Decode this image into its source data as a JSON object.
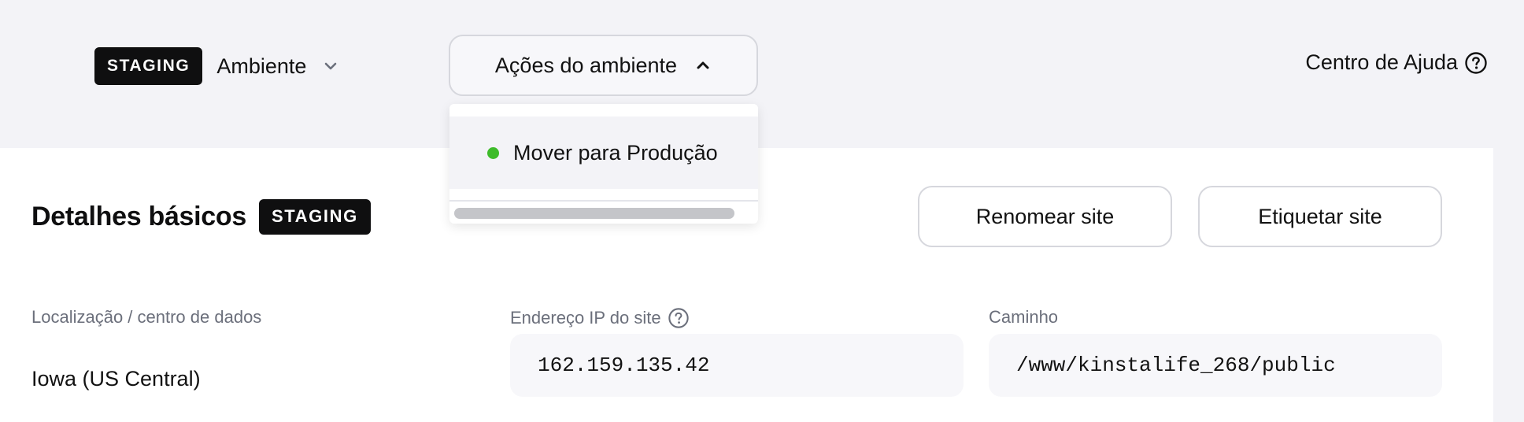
{
  "header": {
    "env_badge": "STAGING",
    "env_label": "Ambiente",
    "env_actions_label": "Ações do ambiente",
    "help_label": "Centro de Ajuda"
  },
  "dropdown": {
    "items": [
      {
        "label": "Mover para Produção",
        "status_color": "#3dbb2a"
      }
    ]
  },
  "card": {
    "title": "Detalhes básicos",
    "badge": "STAGING",
    "rename_button": "Renomear site",
    "tag_button": "Etiquetar site",
    "fields": {
      "location": {
        "label": "Localização / centro de dados",
        "value": "Iowa (US Central)"
      },
      "ip": {
        "label": "Endereço IP do site",
        "value": "162.159.135.42"
      },
      "path": {
        "label": "Caminho",
        "value": "/www/kinstalife_268/public"
      }
    }
  },
  "icons": {
    "env_chevron": "chevron-down-icon",
    "actions_chevron": "chevron-up-icon",
    "help": "question-circle-icon",
    "ip_help": "question-circle-icon"
  },
  "colors": {
    "badge_bg": "#0f0f10",
    "page_bg": "#f3f3f7",
    "card_bg": "#ffffff",
    "label": "#6b6f7b",
    "status_green": "#3dbb2a"
  }
}
